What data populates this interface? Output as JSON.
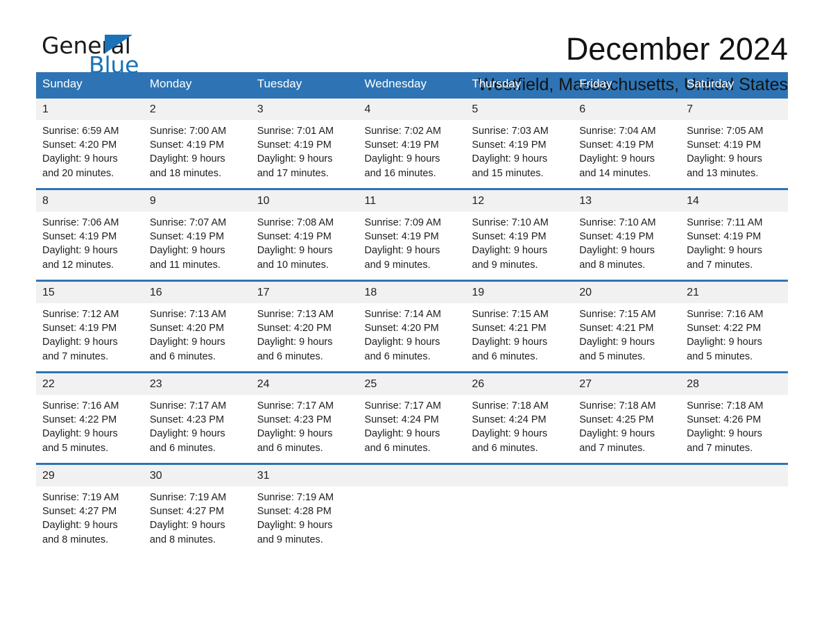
{
  "brand": {
    "word_one": "General",
    "word_two": "Blue",
    "accent_color": "#1a72b8"
  },
  "header": {
    "month_title": "December 2024",
    "location": "Westfield, Massachusetts, United States"
  },
  "theme": {
    "header_blue": "#2e74b5",
    "daynum_band": "#f1f1f1",
    "text": "#1d1d1d"
  },
  "weekday_headers": [
    "Sunday",
    "Monday",
    "Tuesday",
    "Wednesday",
    "Thursday",
    "Friday",
    "Saturday"
  ],
  "weeks": [
    [
      {
        "day": "1",
        "sunrise": "Sunrise: 6:59 AM",
        "sunset": "Sunset: 4:20 PM",
        "daylight_1": "Daylight: 9 hours",
        "daylight_2": "and 20 minutes."
      },
      {
        "day": "2",
        "sunrise": "Sunrise: 7:00 AM",
        "sunset": "Sunset: 4:19 PM",
        "daylight_1": "Daylight: 9 hours",
        "daylight_2": "and 18 minutes."
      },
      {
        "day": "3",
        "sunrise": "Sunrise: 7:01 AM",
        "sunset": "Sunset: 4:19 PM",
        "daylight_1": "Daylight: 9 hours",
        "daylight_2": "and 17 minutes."
      },
      {
        "day": "4",
        "sunrise": "Sunrise: 7:02 AM",
        "sunset": "Sunset: 4:19 PM",
        "daylight_1": "Daylight: 9 hours",
        "daylight_2": "and 16 minutes."
      },
      {
        "day": "5",
        "sunrise": "Sunrise: 7:03 AM",
        "sunset": "Sunset: 4:19 PM",
        "daylight_1": "Daylight: 9 hours",
        "daylight_2": "and 15 minutes."
      },
      {
        "day": "6",
        "sunrise": "Sunrise: 7:04 AM",
        "sunset": "Sunset: 4:19 PM",
        "daylight_1": "Daylight: 9 hours",
        "daylight_2": "and 14 minutes."
      },
      {
        "day": "7",
        "sunrise": "Sunrise: 7:05 AM",
        "sunset": "Sunset: 4:19 PM",
        "daylight_1": "Daylight: 9 hours",
        "daylight_2": "and 13 minutes."
      }
    ],
    [
      {
        "day": "8",
        "sunrise": "Sunrise: 7:06 AM",
        "sunset": "Sunset: 4:19 PM",
        "daylight_1": "Daylight: 9 hours",
        "daylight_2": "and 12 minutes."
      },
      {
        "day": "9",
        "sunrise": "Sunrise: 7:07 AM",
        "sunset": "Sunset: 4:19 PM",
        "daylight_1": "Daylight: 9 hours",
        "daylight_2": "and 11 minutes."
      },
      {
        "day": "10",
        "sunrise": "Sunrise: 7:08 AM",
        "sunset": "Sunset: 4:19 PM",
        "daylight_1": "Daylight: 9 hours",
        "daylight_2": "and 10 minutes."
      },
      {
        "day": "11",
        "sunrise": "Sunrise: 7:09 AM",
        "sunset": "Sunset: 4:19 PM",
        "daylight_1": "Daylight: 9 hours",
        "daylight_2": "and 9 minutes."
      },
      {
        "day": "12",
        "sunrise": "Sunrise: 7:10 AM",
        "sunset": "Sunset: 4:19 PM",
        "daylight_1": "Daylight: 9 hours",
        "daylight_2": "and 9 minutes."
      },
      {
        "day": "13",
        "sunrise": "Sunrise: 7:10 AM",
        "sunset": "Sunset: 4:19 PM",
        "daylight_1": "Daylight: 9 hours",
        "daylight_2": "and 8 minutes."
      },
      {
        "day": "14",
        "sunrise": "Sunrise: 7:11 AM",
        "sunset": "Sunset: 4:19 PM",
        "daylight_1": "Daylight: 9 hours",
        "daylight_2": "and 7 minutes."
      }
    ],
    [
      {
        "day": "15",
        "sunrise": "Sunrise: 7:12 AM",
        "sunset": "Sunset: 4:19 PM",
        "daylight_1": "Daylight: 9 hours",
        "daylight_2": "and 7 minutes."
      },
      {
        "day": "16",
        "sunrise": "Sunrise: 7:13 AM",
        "sunset": "Sunset: 4:20 PM",
        "daylight_1": "Daylight: 9 hours",
        "daylight_2": "and 6 minutes."
      },
      {
        "day": "17",
        "sunrise": "Sunrise: 7:13 AM",
        "sunset": "Sunset: 4:20 PM",
        "daylight_1": "Daylight: 9 hours",
        "daylight_2": "and 6 minutes."
      },
      {
        "day": "18",
        "sunrise": "Sunrise: 7:14 AM",
        "sunset": "Sunset: 4:20 PM",
        "daylight_1": "Daylight: 9 hours",
        "daylight_2": "and 6 minutes."
      },
      {
        "day": "19",
        "sunrise": "Sunrise: 7:15 AM",
        "sunset": "Sunset: 4:21 PM",
        "daylight_1": "Daylight: 9 hours",
        "daylight_2": "and 6 minutes."
      },
      {
        "day": "20",
        "sunrise": "Sunrise: 7:15 AM",
        "sunset": "Sunset: 4:21 PM",
        "daylight_1": "Daylight: 9 hours",
        "daylight_2": "and 5 minutes."
      },
      {
        "day": "21",
        "sunrise": "Sunrise: 7:16 AM",
        "sunset": "Sunset: 4:22 PM",
        "daylight_1": "Daylight: 9 hours",
        "daylight_2": "and 5 minutes."
      }
    ],
    [
      {
        "day": "22",
        "sunrise": "Sunrise: 7:16 AM",
        "sunset": "Sunset: 4:22 PM",
        "daylight_1": "Daylight: 9 hours",
        "daylight_2": "and 5 minutes."
      },
      {
        "day": "23",
        "sunrise": "Sunrise: 7:17 AM",
        "sunset": "Sunset: 4:23 PM",
        "daylight_1": "Daylight: 9 hours",
        "daylight_2": "and 6 minutes."
      },
      {
        "day": "24",
        "sunrise": "Sunrise: 7:17 AM",
        "sunset": "Sunset: 4:23 PM",
        "daylight_1": "Daylight: 9 hours",
        "daylight_2": "and 6 minutes."
      },
      {
        "day": "25",
        "sunrise": "Sunrise: 7:17 AM",
        "sunset": "Sunset: 4:24 PM",
        "daylight_1": "Daylight: 9 hours",
        "daylight_2": "and 6 minutes."
      },
      {
        "day": "26",
        "sunrise": "Sunrise: 7:18 AM",
        "sunset": "Sunset: 4:24 PM",
        "daylight_1": "Daylight: 9 hours",
        "daylight_2": "and 6 minutes."
      },
      {
        "day": "27",
        "sunrise": "Sunrise: 7:18 AM",
        "sunset": "Sunset: 4:25 PM",
        "daylight_1": "Daylight: 9 hours",
        "daylight_2": "and 7 minutes."
      },
      {
        "day": "28",
        "sunrise": "Sunrise: 7:18 AM",
        "sunset": "Sunset: 4:26 PM",
        "daylight_1": "Daylight: 9 hours",
        "daylight_2": "and 7 minutes."
      }
    ],
    [
      {
        "day": "29",
        "sunrise": "Sunrise: 7:19 AM",
        "sunset": "Sunset: 4:27 PM",
        "daylight_1": "Daylight: 9 hours",
        "daylight_2": "and 8 minutes."
      },
      {
        "day": "30",
        "sunrise": "Sunrise: 7:19 AM",
        "sunset": "Sunset: 4:27 PM",
        "daylight_1": "Daylight: 9 hours",
        "daylight_2": "and 8 minutes."
      },
      {
        "day": "31",
        "sunrise": "Sunrise: 7:19 AM",
        "sunset": "Sunset: 4:28 PM",
        "daylight_1": "Daylight: 9 hours",
        "daylight_2": "and 9 minutes."
      },
      {
        "day": "",
        "sunrise": "",
        "sunset": "",
        "daylight_1": "",
        "daylight_2": "",
        "empty": true
      },
      {
        "day": "",
        "sunrise": "",
        "sunset": "",
        "daylight_1": "",
        "daylight_2": "",
        "empty": true
      },
      {
        "day": "",
        "sunrise": "",
        "sunset": "",
        "daylight_1": "",
        "daylight_2": "",
        "empty": true
      },
      {
        "day": "",
        "sunrise": "",
        "sunset": "",
        "daylight_1": "",
        "daylight_2": "",
        "empty": true
      }
    ]
  ]
}
